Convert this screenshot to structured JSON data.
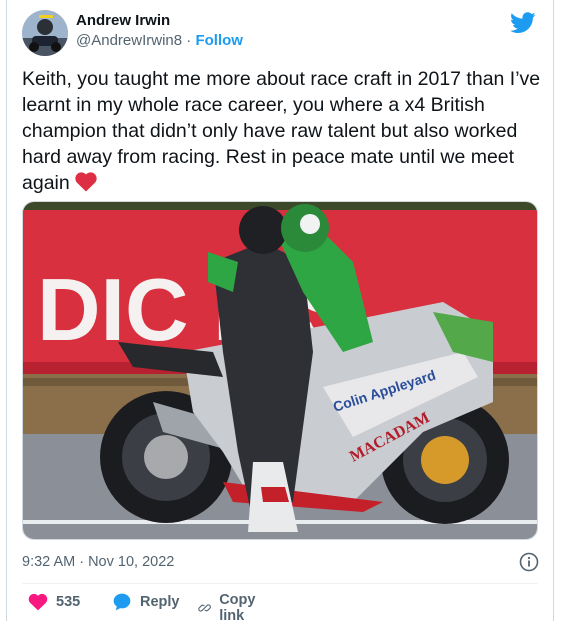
{
  "author": {
    "name": "Andrew Irwin",
    "handle": "@AndrewIrwin8",
    "separator": "·",
    "follow_label": "Follow"
  },
  "tweet": {
    "text": "Keith,  you taught me more about race craft in 2017 than I’ve learnt in my whole race career, you where a x4 British champion that didn’t only have raw talent but also worked hard away from racing.  Rest in peace mate until we meet again",
    "emoji": "red-heart-icon"
  },
  "photo": {
    "banner_text": "DIC  IES",
    "bike_text_1": "Colin Appleyard",
    "bike_text_2": "MACADAM"
  },
  "meta": {
    "timestamp": "9:32 AM · Nov 10, 2022"
  },
  "actions": {
    "likes_count": "535",
    "reply_label": "Reply",
    "copy_label": "Copy link"
  },
  "colors": {
    "twitter_blue": "#1d9bf0",
    "like_pink": "#f91880",
    "text_secondary": "#536471"
  }
}
